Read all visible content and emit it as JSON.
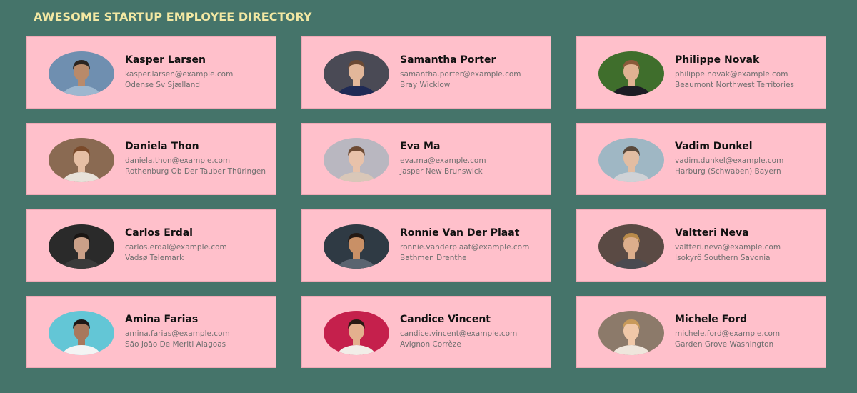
{
  "header": {
    "title": "AWESOME STARTUP EMPLOYEE DIRECTORY"
  },
  "employees": [
    {
      "name": "Kasper Larsen",
      "email": "kasper.larsen@example.com",
      "location": "Odense Sv Sjælland",
      "photo": {
        "bg": "#6f8fb0",
        "skin": "#b98a6a",
        "hair": "#2b2420",
        "shirt": "#9db7cf"
      }
    },
    {
      "name": "Samantha Porter",
      "email": "samantha.porter@example.com",
      "location": "Bray Wicklow",
      "photo": {
        "bg": "#4a4a55",
        "skin": "#e2b79a",
        "hair": "#6b4a34",
        "shirt": "#1f2a55"
      }
    },
    {
      "name": "Philippe Novak",
      "email": "philippe.novak@example.com",
      "location": "Beaumont Northwest Territories",
      "photo": {
        "bg": "#3f6e2c",
        "skin": "#e0b292",
        "hair": "#8a5a3a",
        "shirt": "#1c1c24"
      }
    },
    {
      "name": "Daniela Thon",
      "email": "daniela.thon@example.com",
      "location": "Rothenburg Ob Der Tauber Thüringen",
      "photo": {
        "bg": "#8a6a52",
        "skin": "#e6bfa4",
        "hair": "#7a4a2a",
        "shirt": "#e8e2da"
      }
    },
    {
      "name": "Eva Ma",
      "email": "eva.ma@example.com",
      "location": "Jasper New Brunswick",
      "photo": {
        "bg": "#b9b7c0",
        "skin": "#e8c2aa",
        "hair": "#6e4b34",
        "shirt": "#d9c7b8"
      }
    },
    {
      "name": "Vadim Dunkel",
      "email": "vadim.dunkel@example.com",
      "location": "Harburg (Schwaben) Bayern",
      "photo": {
        "bg": "#9fb7c4",
        "skin": "#e2bda2",
        "hair": "#5a4a3c",
        "shirt": "#cfd2d6"
      }
    },
    {
      "name": "Carlos Erdal",
      "email": "carlos.erdal@example.com",
      "location": "Vadsø Telemark",
      "photo": {
        "bg": "#2a2a2a",
        "skin": "#caa088",
        "hair": "#1a1614",
        "shirt": "#3a3a3a"
      }
    },
    {
      "name": "Ronnie Van Der Plaat",
      "email": "ronnie.vanderplaat@example.com",
      "location": "Bathmen Drenthe",
      "photo": {
        "bg": "#2f3a44",
        "skin": "#c99066",
        "hair": "#241a14",
        "shirt": "#5a6470"
      }
    },
    {
      "name": "Valtteri Neva",
      "email": "valtteri.neva@example.com",
      "location": "Isokyrö Southern Savonia",
      "photo": {
        "bg": "#5a4a44",
        "skin": "#dcae8c",
        "hair": "#b98a4a",
        "shirt": "#4a4a50"
      }
    },
    {
      "name": "Amina Farias",
      "email": "amina.farias@example.com",
      "location": "São João De Meriti Alagoas",
      "photo": {
        "bg": "#63c6d6",
        "skin": "#a8785c",
        "hair": "#1e1816",
        "shirt": "#f4f4f4"
      }
    },
    {
      "name": "Candice Vincent",
      "email": "candice.vincent@example.com",
      "location": "Avignon Corrèze",
      "photo": {
        "bg": "#c5204c",
        "skin": "#e4b08e",
        "hair": "#2a1a14",
        "shirt": "#f2eee8"
      }
    },
    {
      "name": "Michele Ford",
      "email": "michele.ford@example.com",
      "location": "Garden Grove Washington",
      "photo": {
        "bg": "#8c7a6a",
        "skin": "#f0c8a8",
        "hair": "#c89a5a",
        "shirt": "#efe6dc"
      }
    }
  ]
}
